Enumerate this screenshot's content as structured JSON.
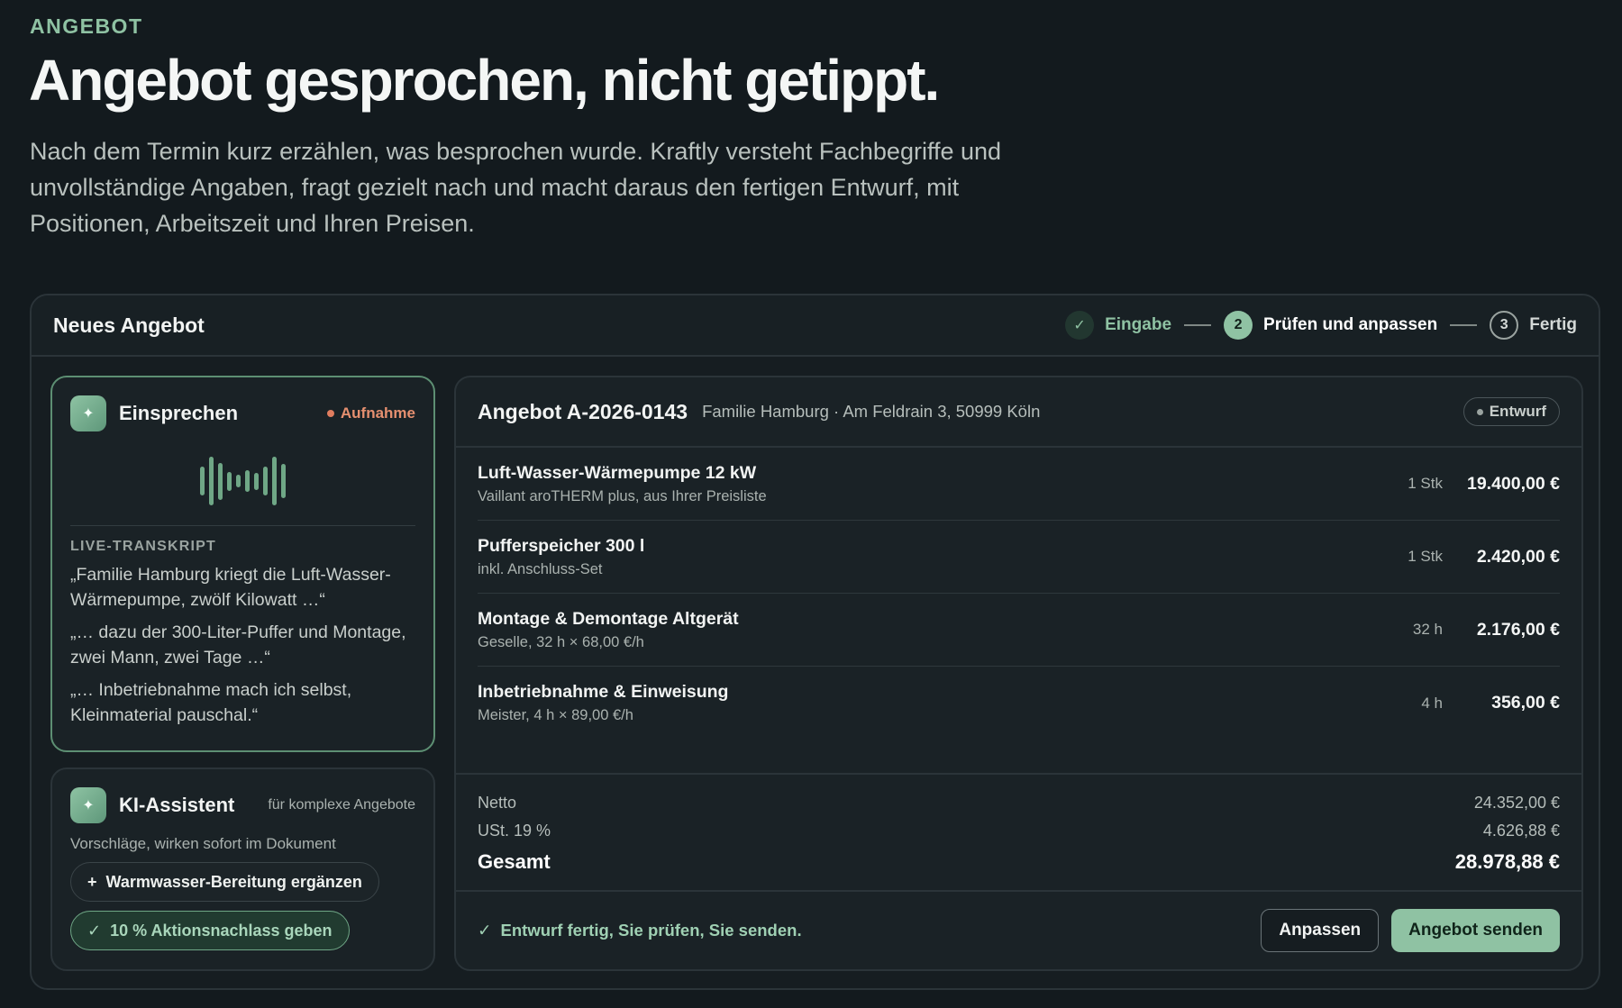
{
  "hero": {
    "eyebrow": "ANGEBOT",
    "title": "Angebot gesprochen, nicht getippt.",
    "subtitle": "Nach dem Termin kurz erzählen, was besprochen wurde. Kraftly versteht Fachbegriffe und unvollständige Angaben, fragt gezielt nach und macht daraus den fertigen Entwurf, mit Positionen, Arbeitszeit und Ihren Preisen."
  },
  "app": {
    "title": "Neues Angebot",
    "steps": [
      {
        "num": "✓",
        "label": "Eingabe",
        "state": "done"
      },
      {
        "num": "2",
        "label": "Prüfen und anpassen",
        "state": "active"
      },
      {
        "num": "3",
        "label": "Fertig",
        "state": "todo"
      }
    ]
  },
  "voice": {
    "icon": "sparkle-icon",
    "title": "Einsprechen",
    "status": "Aufnahme",
    "live_label": "LIVE-TRANSKRIPT",
    "quotes": [
      "„Familie Hamburg kriegt die Luft-Wasser-Wärmepumpe, zwölf Kilowatt …“",
      "„… dazu der 300-Liter-Puffer und Montage, zwei Mann, zwei Tage …“",
      "„… Inbetriebnahme mach ich selbst, Kleinmaterial pauschal.“"
    ]
  },
  "assistant": {
    "icon": "sparkle-icon",
    "title": "KI-Assistent",
    "meta": "für komplexe Angebote",
    "subtitle": "Vorschläge, wirken sofort im Dokument",
    "suggestion_add": "Warmwasser-Bereitung ergänzen",
    "suggestion_applied": "10 % Aktionsnachlass geben"
  },
  "offer": {
    "number": "Angebot A-2026-0143",
    "client": "Familie Hamburg · Am Feldrain 3, 50999 Köln",
    "status": "Entwurf",
    "items": [
      {
        "name": "Luft-Wasser-Wärmepumpe 12 kW",
        "desc": "Vaillant aroTHERM plus, aus Ihrer Preisliste",
        "qty": "1 Stk",
        "price": "19.400,00 €"
      },
      {
        "name": "Pufferspeicher 300 l",
        "desc": "inkl. Anschluss-Set",
        "qty": "1 Stk",
        "price": "2.420,00 €"
      },
      {
        "name": "Montage & Demontage Altgerät",
        "desc": "Geselle, 32 h × 68,00 €/h",
        "qty": "32 h",
        "price": "2.176,00 €"
      },
      {
        "name": "Inbetriebnahme & Einweisung",
        "desc": "Meister, 4 h × 89,00 €/h",
        "qty": "4 h",
        "price": "356,00 €"
      }
    ],
    "totals": {
      "net_label": "Netto",
      "net": "24.352,00 €",
      "tax_label": "USt. 19 %",
      "tax": "4.626,88 €",
      "total_label": "Gesamt",
      "total": "28.978,88 €"
    },
    "footer_message": "Entwurf fertig, Sie prüfen, Sie senden.",
    "btn_adjust": "Anpassen",
    "btn_send": "Angebot senden"
  },
  "colors": {
    "background": "#131a1e",
    "accent": "#8fc2a3",
    "recording": "#e07d5f"
  },
  "waveform_levels": [
    0.6,
    1.0,
    0.75,
    0.38,
    0.25,
    0.45,
    0.35,
    0.6,
    1.0,
    0.7
  ]
}
